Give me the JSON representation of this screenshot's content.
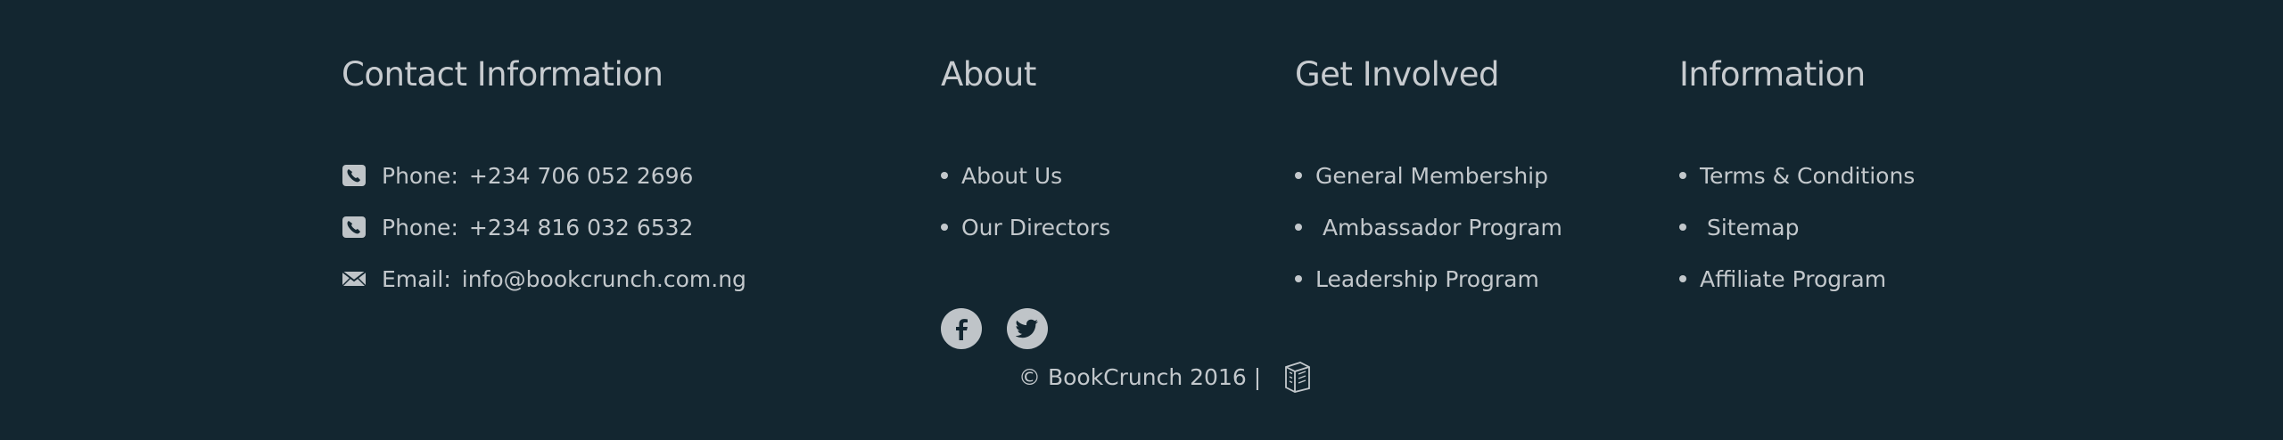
{
  "contact": {
    "heading": "Contact Information",
    "items": [
      {
        "icon": "phone-icon",
        "label": "Phone:",
        "value": "+234 706 052 2696"
      },
      {
        "icon": "phone-icon",
        "label": "Phone:",
        "value": "+234 816 032 6532"
      },
      {
        "icon": "email-icon",
        "label": "Email:",
        "value": "info@bookcrunch.com.ng"
      }
    ]
  },
  "about": {
    "heading": "About",
    "links": [
      "About Us",
      "Our Directors"
    ],
    "social": [
      {
        "icon": "facebook-icon"
      },
      {
        "icon": "twitter-icon"
      }
    ]
  },
  "get_involved": {
    "heading": "Get Involved",
    "links": [
      "General Membership",
      " Ambassador Program",
      "Leadership Program"
    ]
  },
  "information": {
    "heading": "Information",
    "links": [
      "Terms & Conditions",
      " Sitemap",
      "Affiliate Program"
    ]
  },
  "copyright": {
    "text": "© BookCrunch 2016 |",
    "logo_icon": "book-logo-icon"
  },
  "colors": {
    "background": "#132630",
    "text": "#c3c8cc"
  }
}
